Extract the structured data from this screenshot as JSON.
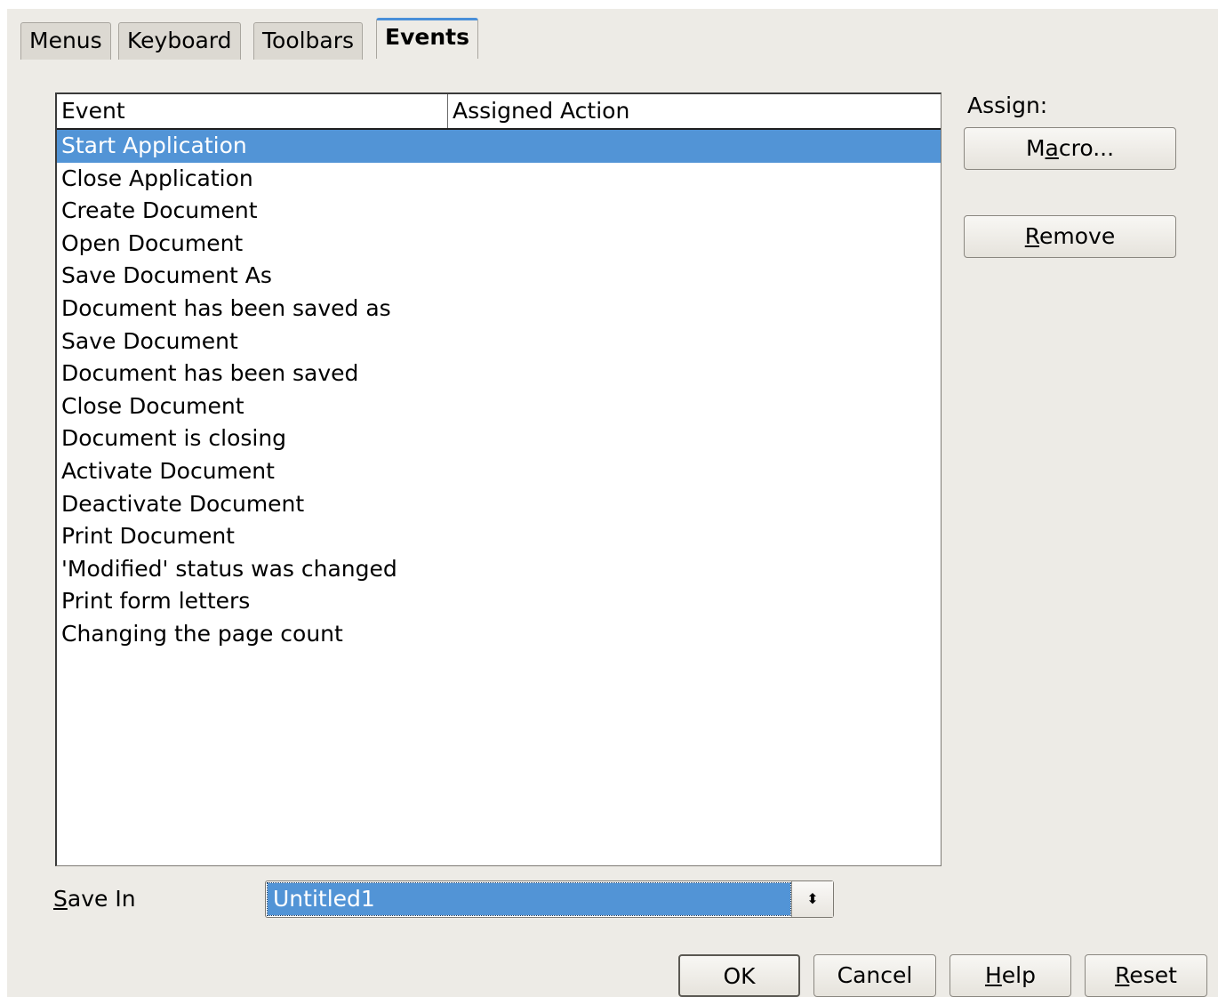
{
  "tabs": [
    {
      "label": "Menus"
    },
    {
      "label": "Keyboard"
    },
    {
      "label": "Toolbars"
    },
    {
      "label": "Events"
    }
  ],
  "active_tab": "Events",
  "list": {
    "columns": [
      "Event",
      "Assigned Action"
    ],
    "rows": [
      "Start Application",
      "Close Application",
      "Create Document",
      "Open Document",
      "Save Document As",
      "Document has been saved as",
      "Save Document",
      "Document has been saved",
      "Close Document",
      "Document is closing",
      "Activate Document",
      "Deactivate Document",
      "Print Document",
      "'Modified' status was changed",
      "Print form letters",
      "Changing the page count"
    ],
    "selected": "Start Application"
  },
  "assign": {
    "label": "Assign:",
    "macro_button": {
      "before": "M",
      "mnemonic": "a",
      "after": "cro..."
    },
    "remove_button": {
      "before": "",
      "mnemonic": "R",
      "after": "emove"
    }
  },
  "save_in": {
    "label_mnemonic": "S",
    "label_rest": "ave In",
    "value": "Untitled1",
    "arrow_glyph": "⬍"
  },
  "footer": {
    "ok": "OK",
    "cancel": "Cancel",
    "help": {
      "mnemonic": "H",
      "rest": "elp"
    },
    "reset": {
      "mnemonic": "R",
      "rest": "eset"
    }
  },
  "colors": {
    "selection": "#5294d6",
    "dialog_bg": "#edebe6",
    "tab_accent": "#4a90d9"
  }
}
